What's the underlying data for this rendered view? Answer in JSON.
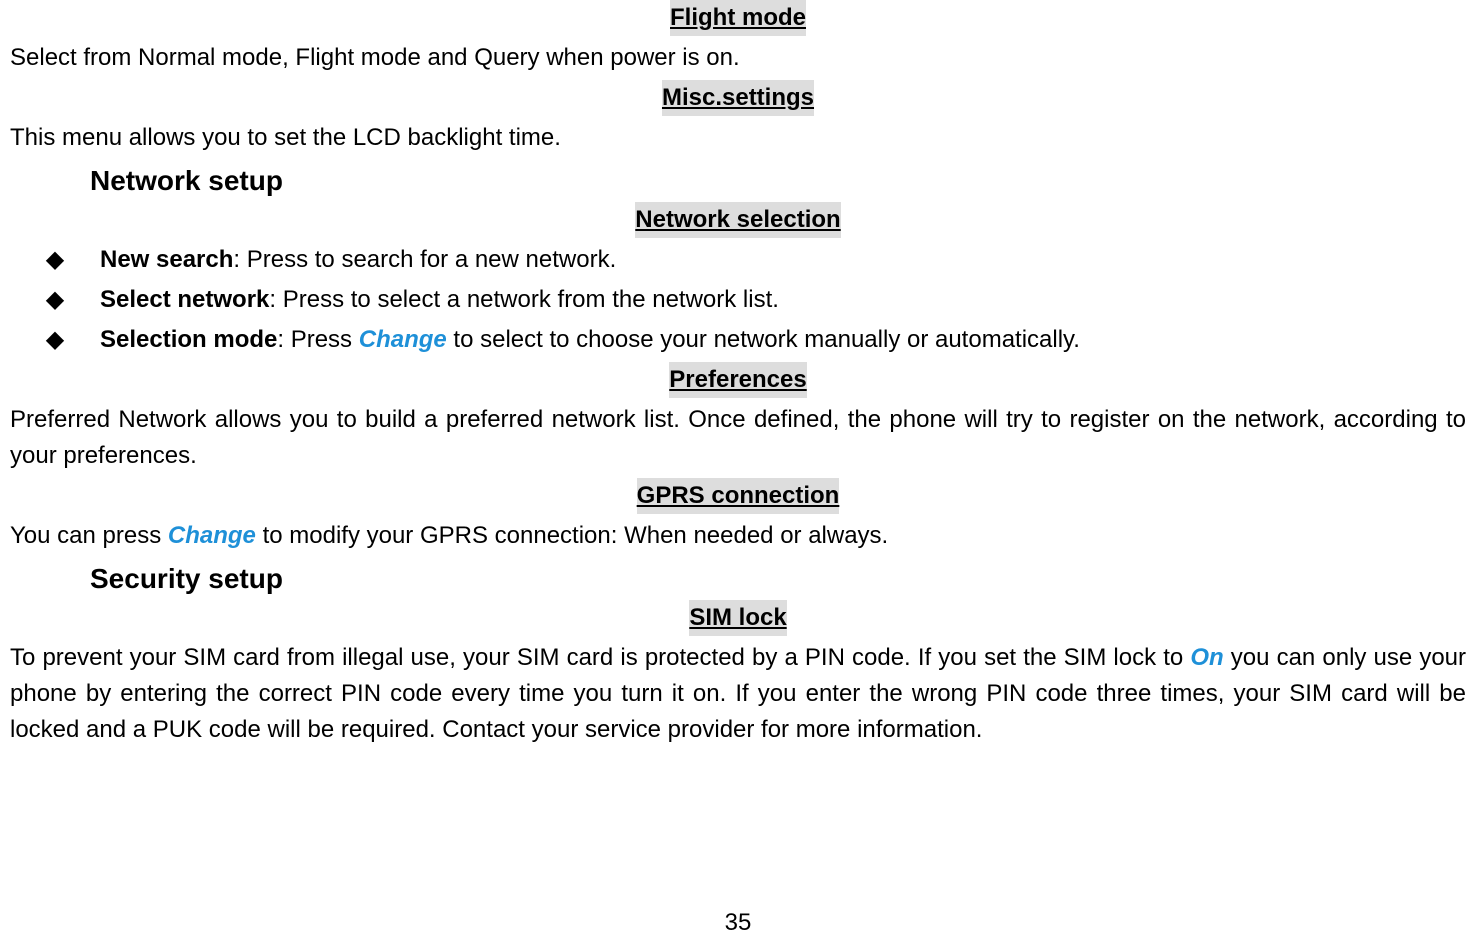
{
  "page_number": "35",
  "sections": {
    "flight_mode": {
      "title": "Flight mode",
      "text": "Select from Normal mode, Flight mode and Query when power is on."
    },
    "misc_settings": {
      "title": "Misc.settings",
      "text": "This menu allows you to set the LCD backlight time."
    },
    "network_setup": {
      "title": "Network setup",
      "network_selection": {
        "title": "Network selection",
        "items": [
          {
            "label": "New search",
            "desc": ": Press to search for a new network."
          },
          {
            "label": "Select network",
            "desc": ": Press to select a network from the network list."
          },
          {
            "label": "Selection mode",
            "desc_before": ": Press ",
            "accent": "Change",
            "desc_after": " to select to choose your network manually or automatically."
          }
        ]
      },
      "preferences": {
        "title": "Preferences",
        "text": "Preferred Network allows you to build a preferred network list. Once defined, the phone will try to register on the network, according to your preferences."
      },
      "gprs": {
        "title": "GPRS connection",
        "text_before": "You can press ",
        "accent": "Change",
        "text_after": " to modify your GPRS connection: When needed or always."
      }
    },
    "security_setup": {
      "title": "Security setup",
      "sim_lock": {
        "title": "SIM lock",
        "text_before": "To prevent your SIM card from illegal use, your SIM card is protected by a PIN code. If you set the SIM lock to ",
        "accent": "On",
        "text_after": " you can only use your phone by entering the correct PIN code every time you turn it on. If you enter the wrong PIN code three times, your SIM card will be locked and a PUK code will be required. Contact your service provider for more information."
      }
    }
  }
}
